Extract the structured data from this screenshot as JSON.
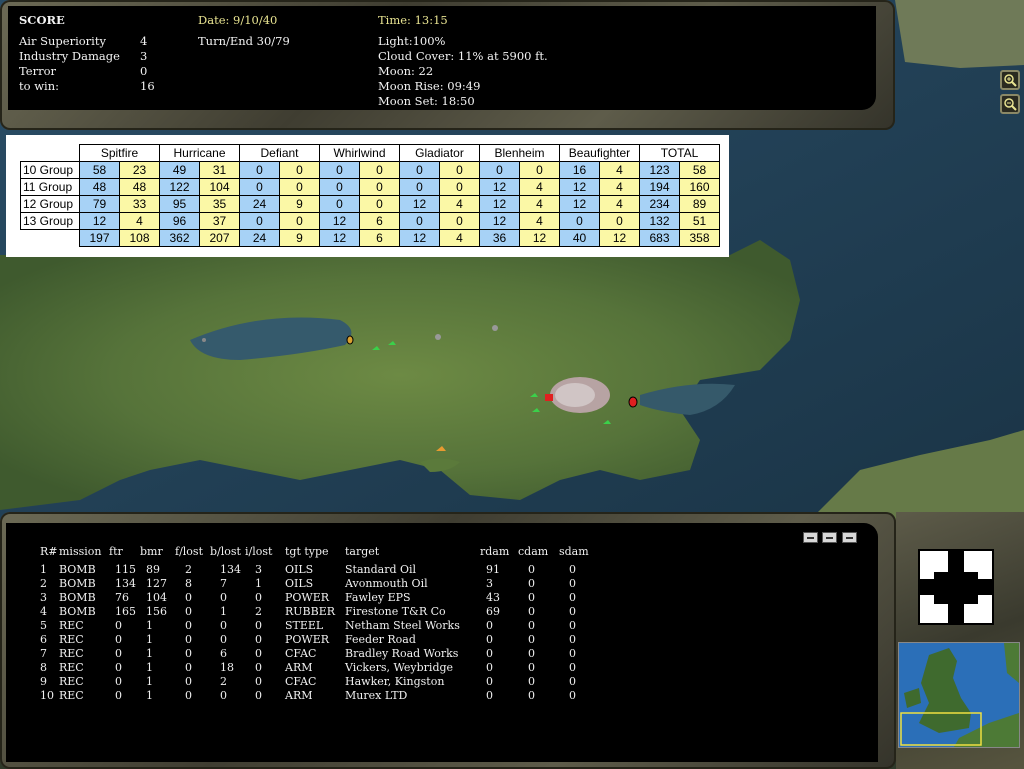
{
  "score": {
    "title": "SCORE",
    "rows": [
      {
        "label": "Air Superiority",
        "value": "4"
      },
      {
        "label": "Industry Damage",
        "value": "3"
      },
      {
        "label": "Terror",
        "value": "0"
      },
      {
        "label": "to win:",
        "value": "16"
      }
    ],
    "date": "Date: 9/10/40",
    "turn": "Turn/End 30/79",
    "time": "Time: 13:15",
    "conditions": [
      "Light:100%",
      "Cloud Cover: 11% at 5900 ft.",
      "Moon: 22",
      "Moon Rise: 09:49",
      "Moon Set: 18:50"
    ]
  },
  "zoom": {
    "in_icon": "zoom-in-icon",
    "out_icon": "zoom-out-icon"
  },
  "aircraft_table": {
    "types": [
      "Spitfire",
      "Hurricane",
      "Defiant",
      "Whirlwind",
      "Gladiator",
      "Blenheim",
      "Beaufighter",
      "TOTAL"
    ],
    "rows": [
      {
        "group": "10 Group",
        "values": [
          "58",
          "23",
          "49",
          "31",
          "0",
          "0",
          "0",
          "0",
          "0",
          "0",
          "0",
          "0",
          "16",
          "4",
          "123",
          "58"
        ]
      },
      {
        "group": "11 Group",
        "values": [
          "48",
          "48",
          "122",
          "104",
          "0",
          "0",
          "0",
          "0",
          "0",
          "0",
          "12",
          "4",
          "12",
          "4",
          "194",
          "160"
        ]
      },
      {
        "group": "12 Group",
        "values": [
          "79",
          "33",
          "95",
          "35",
          "24",
          "9",
          "0",
          "0",
          "12",
          "4",
          "12",
          "4",
          "12",
          "4",
          "234",
          "89"
        ]
      },
      {
        "group": "13 Group",
        "values": [
          "12",
          "4",
          "96",
          "37",
          "0",
          "0",
          "12",
          "6",
          "0",
          "0",
          "12",
          "4",
          "0",
          "0",
          "132",
          "51"
        ]
      }
    ],
    "totals": [
      "197",
      "108",
      "362",
      "207",
      "24",
      "9",
      "12",
      "6",
      "12",
      "4",
      "36",
      "12",
      "40",
      "12",
      "683",
      "358"
    ]
  },
  "missions": {
    "headers": [
      "R#",
      "mission",
      "ftr",
      "bmr",
      "f/lost",
      "b/lost",
      "i/lost",
      "tgt type",
      "target",
      "rdam",
      "cdam",
      "sdam"
    ],
    "rows": [
      [
        "1",
        "BOMB",
        "115",
        "89",
        "2",
        "134",
        "3",
        "OILS",
        "Standard Oil",
        "91",
        "0",
        "0"
      ],
      [
        "2",
        "BOMB",
        "134",
        "127",
        "8",
        "7",
        "1",
        "OILS",
        "Avonmouth Oil",
        "3",
        "0",
        "0"
      ],
      [
        "3",
        "BOMB",
        "76",
        "104",
        "0",
        "0",
        "0",
        "POWER",
        "Fawley EPS",
        "43",
        "0",
        "0"
      ],
      [
        "4",
        "BOMB",
        "165",
        "156",
        "0",
        "1",
        "2",
        "RUBBER",
        "Firestone T&R Co",
        "69",
        "0",
        "0"
      ],
      [
        "5",
        "REC",
        "0",
        "1",
        "0",
        "0",
        "0",
        "STEEL",
        "Netham Steel Works",
        "0",
        "0",
        "0"
      ],
      [
        "6",
        "REC",
        "0",
        "1",
        "0",
        "0",
        "0",
        "POWER",
        "Feeder Road",
        "0",
        "0",
        "0"
      ],
      [
        "7",
        "REC",
        "0",
        "1",
        "0",
        "6",
        "0",
        "CFAC",
        "Bradley Road Works",
        "0",
        "0",
        "0"
      ],
      [
        "8",
        "REC",
        "0",
        "1",
        "0",
        "18",
        "0",
        "ARM",
        "Vickers, Weybridge",
        "0",
        "0",
        "0"
      ],
      [
        "9",
        "REC",
        "0",
        "1",
        "0",
        "2",
        "0",
        "CFAC",
        "Hawker, Kingston",
        "0",
        "0",
        "0"
      ],
      [
        "10",
        "REC",
        "0",
        "1",
        "0",
        "0",
        "0",
        "ARM",
        "Murex LTD",
        "0",
        "0",
        "0"
      ]
    ]
  },
  "colors": {
    "cell_blue": "#a7d2f6",
    "cell_yellow": "#fbf8a6",
    "label_yellow": "#e8e391",
    "sea": "#1e3f55",
    "land": "#5e7a3c"
  }
}
